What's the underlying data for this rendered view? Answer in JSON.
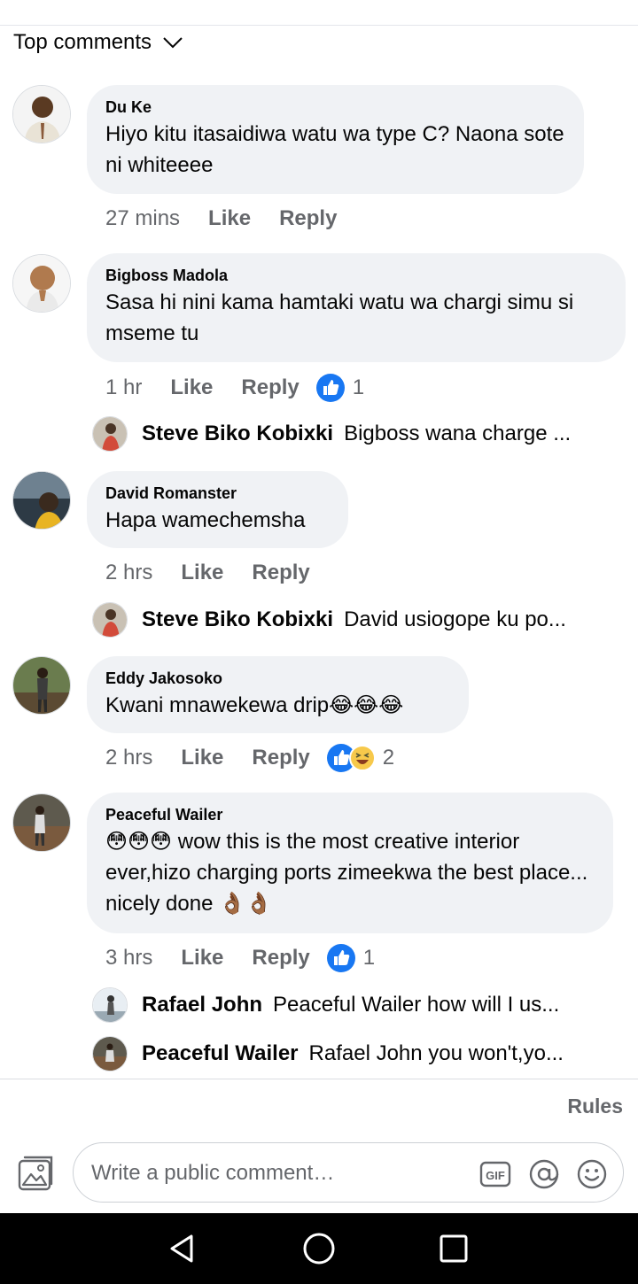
{
  "sort": {
    "label": "Top comments"
  },
  "comments": [
    {
      "name": "Du Ke",
      "text": "Hiyo kitu itasaidiwa watu wa type C? Naona sote ni whiteeee",
      "time": "27 mins",
      "like": "Like",
      "reply": "Reply"
    },
    {
      "name": "Bigboss Madola",
      "text": "Sasa hi nini kama hamtaki watu wa chargi simu si mseme tu",
      "time": "1 hr",
      "like": "Like",
      "reply": "Reply",
      "reactions": "1",
      "replies": [
        {
          "name": "Steve Biko Kobixki",
          "text": "Bigboss wana charge ..."
        }
      ]
    },
    {
      "name": "David Romanster",
      "text": "Hapa wamechemsha",
      "time": "2 hrs",
      "like": "Like",
      "reply": "Reply",
      "replies": [
        {
          "name": "Steve Biko Kobixki",
          "text": "David usiogope ku po..."
        }
      ]
    },
    {
      "name": "Eddy Jakosoko",
      "text": "Kwani mnawekewa drip",
      "emoji": "😂😂😂",
      "time": "2 hrs",
      "like": "Like",
      "reply": "Reply",
      "reactions": "2"
    },
    {
      "name": "Peaceful Wailer",
      "emoji_lead": "😳😳😳",
      "text": " wow this is the most creative interior ever,hizo charging ports zimeekwa the best place... nicely done ",
      "emoji_tail": "👌🏾👌🏾",
      "time": "3 hrs",
      "like": "Like",
      "reply": "Reply",
      "reactions": "1",
      "replies": [
        {
          "name": "Rafael John",
          "text": "Peaceful Wailer how will I us..."
        },
        {
          "name": "Peaceful Wailer",
          "text": "Rafael John you won't,yo..."
        }
      ]
    }
  ],
  "footer": {
    "rules": "Rules"
  },
  "composer": {
    "placeholder": "Write a public comment…"
  },
  "colors": {
    "accent": "#1877f2",
    "bubble": "#f0f2f5",
    "meta": "#65676b"
  },
  "icons": [
    "chevron-down-icon",
    "like-reaction-icon",
    "haha-reaction-icon",
    "photo-icon",
    "gif-icon",
    "mention-icon",
    "emoji-icon",
    "back-icon",
    "home-icon",
    "recents-icon"
  ]
}
